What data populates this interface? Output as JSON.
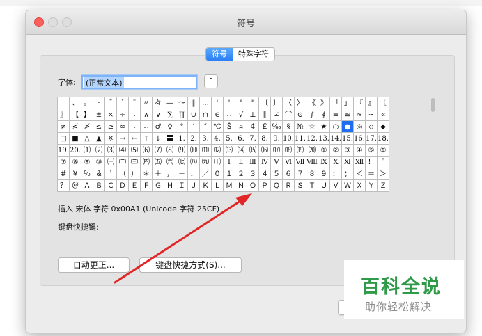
{
  "window": {
    "title": "符号"
  },
  "tabs": [
    {
      "label": "符号"
    },
    {
      "label": "特殊字符"
    }
  ],
  "font": {
    "label": "字体:",
    "value": "(正常文本)"
  },
  "grid": {
    "rows": [
      [
        "",
        "、",
        "。",
        "·",
        "ˉ",
        "ˇ",
        "¨",
        "〃",
        "々",
        "—",
        "～",
        "‖",
        "…",
        "'",
        "'",
        "\"",
        "\"",
        "〔",
        "〕",
        "〈",
        "〉",
        "《",
        "》",
        "「",
        "」",
        "『",
        "』",
        "〖"
      ],
      [
        "〗",
        "【",
        "】",
        "±",
        "×",
        "÷",
        "∶",
        "∧",
        "∨",
        "∑",
        "∏",
        "∪",
        "∩",
        "∈",
        "∷",
        "√",
        "⊥",
        "∥",
        "∠",
        "⌒",
        "⊙",
        "∫",
        "∮",
        "≡",
        "≌",
        "≈",
        "∽",
        "∝"
      ],
      [
        "≠",
        "≮",
        "≯",
        "≤",
        "≥",
        "∞",
        "∵",
        "∴",
        "♂",
        "♀",
        "°",
        "′",
        "″",
        "℃",
        "＄",
        "¤",
        "￠",
        "￡",
        "‰",
        "§",
        "№",
        "☆",
        "★",
        "○",
        "●",
        "◎",
        "◇",
        "◆"
      ],
      [
        "□",
        "■",
        "△",
        "▲",
        "※",
        "→",
        "←",
        "↑",
        "↓",
        "〓",
        "1.",
        "2.",
        "3.",
        "4.",
        "5.",
        "6.",
        "7.",
        "8.",
        "9.",
        "10.",
        "11.",
        "12.",
        "13.",
        "14.",
        "15.",
        "16.",
        "17.",
        "18."
      ],
      [
        "19.",
        "20.",
        "⑴",
        "⑵",
        "⑶",
        "⑷",
        "⑸",
        "⑹",
        "⑺",
        "⑻",
        "⑼",
        "⑽",
        "⑾",
        "⑿",
        "⒀",
        "⒁",
        "⒂",
        "⒃",
        "⒄",
        "⒅",
        "⒆",
        "⒇",
        "①",
        "②",
        "③",
        "④",
        "⑤",
        "⑥"
      ],
      [
        "⑦",
        "⑧",
        "⑨",
        "⑩",
        "㈠",
        "㈡",
        "㈢",
        "㈣",
        "㈤",
        "㈥",
        "㈦",
        "㈧",
        "㈨",
        "㈩",
        "Ⅰ",
        "Ⅱ",
        "Ⅲ",
        "Ⅳ",
        "Ⅴ",
        "Ⅵ",
        "Ⅶ",
        "Ⅷ",
        "Ⅸ",
        "Ⅹ",
        "Ⅺ",
        "Ⅻ",
        "！",
        "＂"
      ],
      [
        "＃",
        "￥",
        "％",
        "＆",
        "＇",
        "（",
        "）",
        "＊",
        "＋",
        "，",
        "－",
        "．",
        "／",
        "０",
        "１",
        "２",
        "３",
        "４",
        "５",
        "６",
        "７",
        "８",
        "９",
        "：",
        "；",
        "＜",
        "＝",
        "＞"
      ],
      [
        "？",
        "＠",
        "Ａ",
        "Ｂ",
        "Ｃ",
        "Ｄ",
        "Ｅ",
        "Ｆ",
        "Ｇ",
        "Ｈ",
        "Ｉ",
        "Ｊ",
        "Ｋ",
        "Ｌ",
        "Ｍ",
        "Ｎ",
        "Ｏ",
        "Ｐ",
        "Ｑ",
        "Ｒ",
        "Ｓ",
        "Ｔ",
        "Ｕ",
        "Ｖ",
        "Ｗ",
        "Ｘ",
        "Ｙ",
        "Ｚ"
      ]
    ],
    "selected": "●"
  },
  "info": {
    "insert": "插入 宋体 字符 0x00A1 (Unicode 字符 25CF)",
    "shortcut_label": "键盘快捷键:"
  },
  "buttons": {
    "autocorrect": "自动更正...",
    "shortcut": "键盘快捷方式(S)..."
  },
  "watermark": {
    "title": "百科全说",
    "subtitle": "助你轻松解决"
  },
  "colors": {
    "accent": "#2a7ff6",
    "arrow": "#e02626",
    "watermark": "#2f9b49"
  }
}
